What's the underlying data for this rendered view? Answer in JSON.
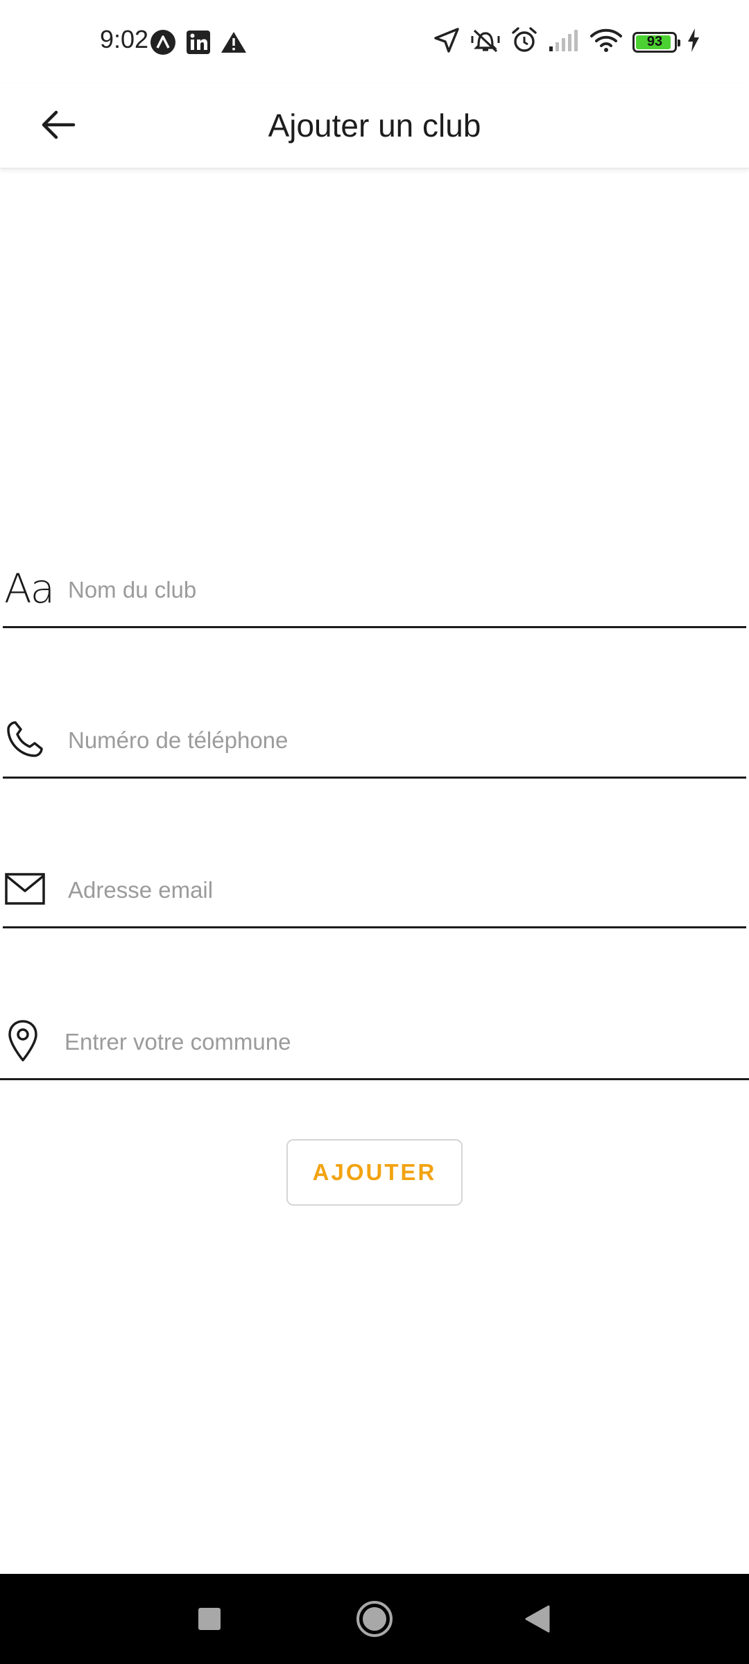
{
  "status_bar": {
    "time": "9:02",
    "left_icons": [
      "app-a-icon",
      "linkedin-icon",
      "warning-icon"
    ],
    "right_icons": [
      "location-arrow-icon",
      "vibrate-off-icon",
      "alarm-icon",
      "signal-icon",
      "wifi-icon",
      "battery-icon",
      "charging-icon"
    ],
    "battery_level": 93,
    "battery_color": "#4cd132"
  },
  "app_bar": {
    "title": "Ajouter un club",
    "back_icon": "arrow-back-icon"
  },
  "form": {
    "fields": [
      {
        "icon": "text-format-icon",
        "icon_text": "Aa",
        "placeholder": "Nom du club",
        "value": ""
      },
      {
        "icon": "phone-icon",
        "placeholder": "Numéro de téléphone",
        "value": ""
      },
      {
        "icon": "mail-icon",
        "placeholder": "Adresse email",
        "value": ""
      },
      {
        "icon": "location-pin-icon",
        "placeholder": "Entrer votre commune",
        "value": ""
      }
    ],
    "submit_label": "AJOUTER",
    "accent_color": "#f2a311"
  },
  "nav_bar": {
    "buttons": [
      "recents-square-icon",
      "home-circle-icon",
      "back-triangle-icon"
    ]
  }
}
